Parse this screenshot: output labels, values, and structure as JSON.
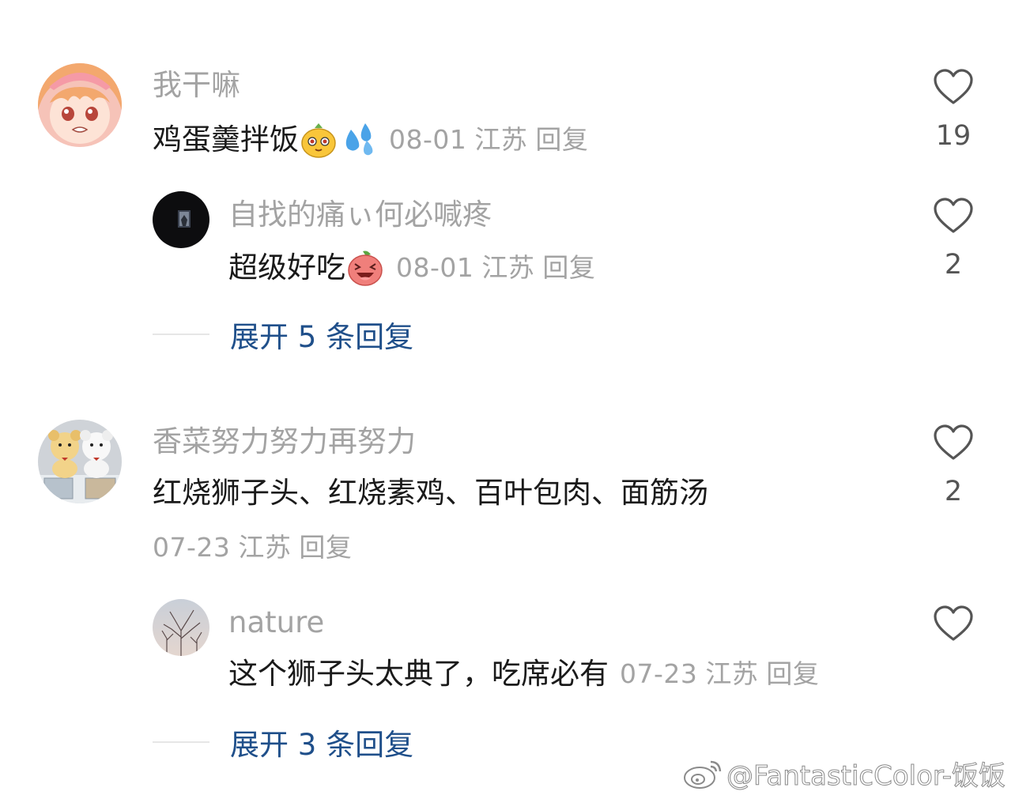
{
  "comments": [
    {
      "username": "我干嘛",
      "text": "鸡蛋羹拌饭",
      "emojis": [
        "orange-face-emoji",
        "sweat-drops-emoji"
      ],
      "date": "08-01",
      "location": "江苏",
      "reply_label": "回复",
      "likes": "19",
      "avatar": "anime-girl-avatar",
      "replies": [
        {
          "username": "自找的痛ぃ何必喊疼",
          "text": "超级好吃",
          "emojis": [
            "laughing-peach-emoji"
          ],
          "date": "08-01",
          "location": "江苏",
          "reply_label": "回复",
          "likes": "2",
          "avatar": "dark-window-avatar"
        }
      ],
      "expand_label": "展开 5 条回复"
    },
    {
      "username": "香菜努力努力再努力",
      "text": "红烧狮子头、红烧素鸡、百叶包肉、面筋汤",
      "date": "07-23",
      "location": "江苏",
      "reply_label": "回复",
      "likes": "2",
      "avatar": "plush-toys-avatar",
      "replies": [
        {
          "username": "nature",
          "text": "这个狮子头太典了，吃席必有",
          "date": "07-23",
          "location": "江苏",
          "reply_label": "回复",
          "likes": "",
          "avatar": "bare-tree-avatar"
        }
      ],
      "expand_label": "展开 3 条回复"
    }
  ],
  "watermark": "@FantasticColor-饭饭",
  "colors": {
    "username": "#a3a3a3",
    "text": "#1a1a1a",
    "link": "#1f4f8a",
    "heart": "#555555"
  }
}
